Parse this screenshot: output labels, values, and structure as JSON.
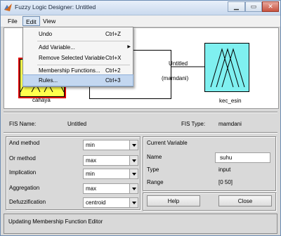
{
  "window": {
    "title": "Fuzzy Logic Designer: Untitled"
  },
  "menu_bar": [
    "File",
    "Edit",
    "View"
  ],
  "edit_menu": {
    "items": [
      {
        "label": "Undo",
        "shortcut": "Ctrl+Z"
      },
      {
        "label": "Add Variable...",
        "shortcut": ""
      },
      {
        "label": "Remove Selected Variable",
        "shortcut": "Ctrl+X"
      },
      {
        "label": "Membership Functions...",
        "shortcut": "Ctrl+2"
      },
      {
        "label": "Rules...",
        "shortcut": "Ctrl+3"
      }
    ]
  },
  "diagram": {
    "fis_box_name": "Untitled",
    "fis_box_type": "(mamdani)",
    "input_variable": "cahaya",
    "output_variable": "kec_esin"
  },
  "fis_info": {
    "name_label": "FIS Name:",
    "name_value": "Untitled",
    "type_label": "FIS Type:",
    "type_value": "mamdani"
  },
  "methods": [
    {
      "label": "And method",
      "value": "min"
    },
    {
      "label": "Or method",
      "value": "max"
    },
    {
      "label": "Implication",
      "value": "min"
    },
    {
      "label": "Aggregation",
      "value": "max"
    },
    {
      "label": "Defuzzification",
      "value": "centroid"
    }
  ],
  "current_variable": {
    "title": "Current Variable",
    "name_label": "Name",
    "name_value": "suhu",
    "type_label": "Type",
    "type_value": "input",
    "range_label": "Range",
    "range_value": "[0 50]"
  },
  "buttons": {
    "help": "Help",
    "close": "Close"
  },
  "status": "Updating Membership Function Editor",
  "colors": {
    "input_box": "#ffff4d",
    "output_box": "#7ff0f0",
    "menu_highlight": "#c3d7f0"
  }
}
